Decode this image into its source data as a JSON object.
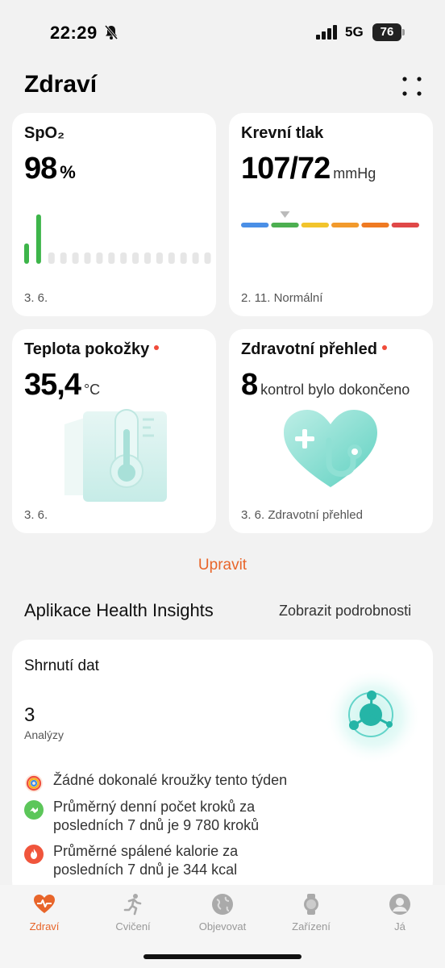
{
  "status_bar": {
    "time": "22:29",
    "network": "5G",
    "battery": "76"
  },
  "header": {
    "title": "Zdraví"
  },
  "cards": {
    "spo2": {
      "title": "SpO₂",
      "value": "98",
      "unit": "%",
      "date": "3. 6.",
      "bars_level": [
        0.35,
        0.85
      ],
      "color": "#3db54a"
    },
    "blood_pressure": {
      "title": "Krevní tlak",
      "value": "107/72",
      "unit": "mmHg",
      "footer": "2. 11. Normální",
      "scale_colors": [
        "#4a8fe6",
        "#4caf50",
        "#f2c42c",
        "#f29a2c",
        "#ef7a22",
        "#e04848"
      ],
      "marker_segment": 1
    },
    "skin_temp": {
      "title": "Teplota pokožky",
      "value": "35,4",
      "unit": "°C",
      "date": "3. 6."
    },
    "health_overview": {
      "title": "Zdravotní přehled",
      "value": "8",
      "unit": "kontrol bylo dokončeno",
      "footer": "3. 6. Zdravotní přehled"
    }
  },
  "edit_label": "Upravit",
  "insights": {
    "section_title": "Aplikace Health Insights",
    "details_link": "Zobrazit podrobnosti",
    "card_title": "Shrnutí dat",
    "count": "3",
    "count_label": "Analýzy",
    "items": [
      {
        "icon": "rings-icon",
        "text": "Žádné dokonalé kroužky tento týden"
      },
      {
        "icon": "steps-icon",
        "text": "Průměrný denní počet kroků za posledních 7 dnů je 9 780 kroků"
      },
      {
        "icon": "flame-icon",
        "text": "Průměrné spálené kalorie za posledních 7 dnů je 344 kcal"
      }
    ]
  },
  "tabs": [
    {
      "label": "Zdraví",
      "icon": "heart-pulse-icon",
      "active": true
    },
    {
      "label": "Cvičení",
      "icon": "running-icon",
      "active": false
    },
    {
      "label": "Objevovat",
      "icon": "globe-icon",
      "active": false
    },
    {
      "label": "Zařízení",
      "icon": "watch-icon",
      "active": false
    },
    {
      "label": "Já",
      "icon": "profile-icon",
      "active": false
    }
  ],
  "colors": {
    "accent": "#e8652a",
    "teal": "#2ec4b6"
  }
}
